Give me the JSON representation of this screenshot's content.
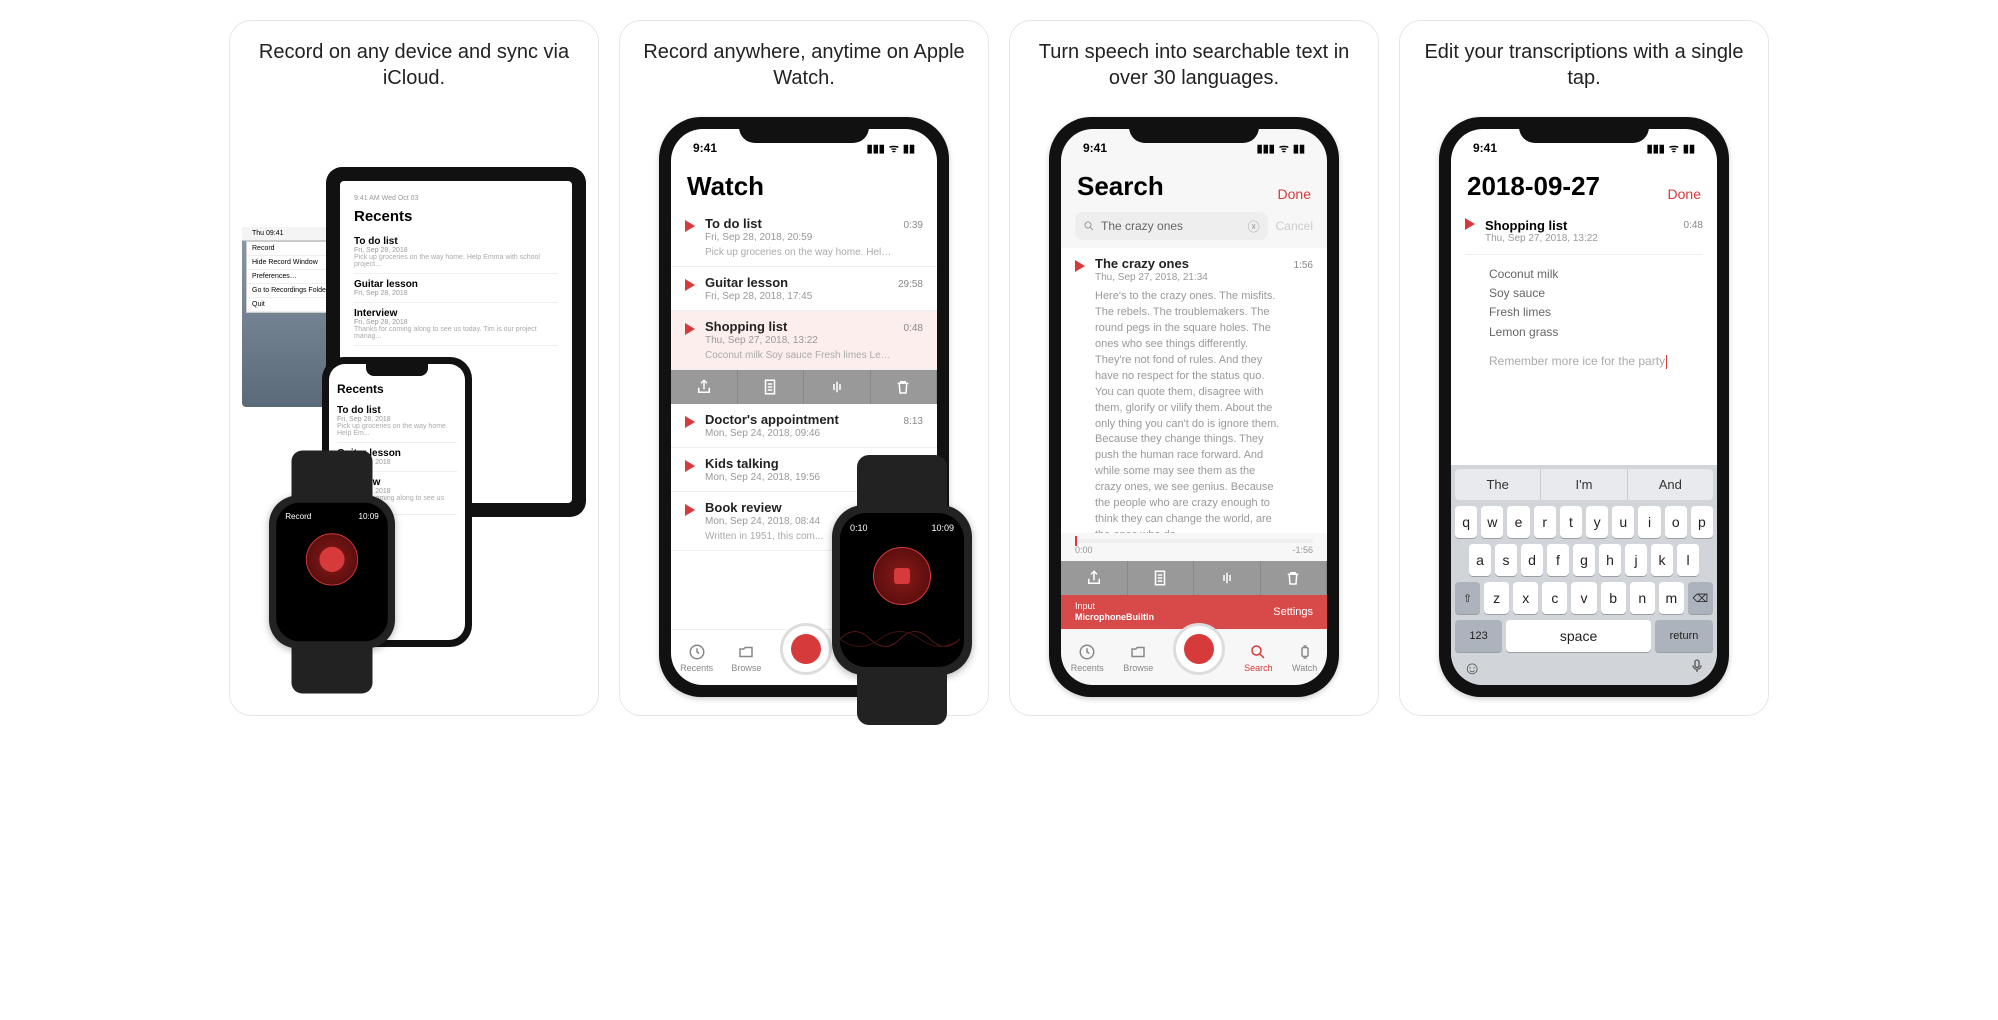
{
  "shots": [
    {
      "caption": "Record on any device and sync via iCloud."
    },
    {
      "caption": "Record anywhere, anytime on Apple Watch."
    },
    {
      "caption": "Turn speech into searchable text in over 30 languages."
    },
    {
      "caption": "Edit your transcriptions with a single tap."
    }
  ],
  "status": {
    "time": "9:41"
  },
  "accent": "#d63a3a",
  "shot1": {
    "mac": {
      "menubar_time": "Thu 09:41",
      "menu_items": [
        "Record",
        "Hide Record Window",
        "Preferences…",
        "Go to Recordings Folder",
        "Quit"
      ]
    },
    "ipad": {
      "statusbar": "9:41 AM   Wed Oct 03",
      "title": "Recents",
      "items": [
        {
          "title": "To do list",
          "sub": "Fri, Sep 28, 2018",
          "preview": "Pick up groceries on the way home. Help Emma with school project..."
        },
        {
          "title": "Guitar lesson",
          "sub": "Fri, Sep 28, 2018"
        },
        {
          "title": "Interview",
          "sub": "Fri, Sep 28, 2018",
          "preview": "Thanks for coming along to see us today. Tim is our project manag..."
        }
      ]
    },
    "iphone": {
      "title": "Recents",
      "items": [
        {
          "title": "To do list",
          "sub": "Fri, Sep 28, 2018",
          "preview": "Pick up groceries on the way home. Help Em..."
        },
        {
          "title": "Guitar lesson",
          "sub": "Fri, Sep 28, 2018"
        },
        {
          "title": "Interview",
          "sub": "Fri, Sep 28, 2018",
          "preview": "Thanks for coming along to see us today. Ti..."
        }
      ]
    },
    "watch": {
      "label": "Record",
      "time": "10:09"
    }
  },
  "shot2": {
    "title": "Watch",
    "items": [
      {
        "title": "To do list",
        "sub": "Fri, Sep 28, 2018, 20:59",
        "dur": "0:39",
        "preview": "Pick up groceries on the way home. Help Em..."
      },
      {
        "title": "Guitar lesson",
        "sub": "Fri, Sep 28, 2018, 17:45",
        "dur": "29:58"
      },
      {
        "title": "Shopping list",
        "sub": "Thu, Sep 27, 2018, 13:22",
        "dur": "0:48",
        "preview": "Coconut milk Soy sauce Fresh limes Lemon g...",
        "selected": true
      },
      {
        "title": "Doctor's appointment",
        "sub": "Mon, Sep 24, 2018, 09:46",
        "dur": "8:13"
      },
      {
        "title": "Kids talking",
        "sub": "Mon, Sep 24, 2018, 19:56",
        "dur": ""
      },
      {
        "title": "Book review",
        "sub": "Mon, Sep 24, 2018, 08:44",
        "dur": "",
        "preview": "Written in 1951, this com..."
      }
    ],
    "tabs": [
      "Recents",
      "Browse"
    ],
    "watch": {
      "elapsed": "0:10",
      "time": "10:09"
    }
  },
  "shot3": {
    "title": "Search",
    "done": "Done",
    "query": "The crazy ones",
    "cancel": "Cancel",
    "result": {
      "title": "The crazy ones",
      "sub": "Thu, Sep 27, 2018, 21:34",
      "dur": "1:56",
      "transcript": "Here's to the crazy ones. The misfits. The rebels. The troublemakers. The round pegs in the square holes. The ones who see things differently. They're not fond of rules. And they have no respect for the status quo. You can quote them, disagree with them, glorify or vilify them. About the only thing you can't do is ignore them. Because they change things. They push the human race forward. And while some may see them as the crazy ones, we see genius. Because the people who are crazy enough to think they can change the world, are the ones who do."
    },
    "track": {
      "start": "0:00",
      "end": "-1:56"
    },
    "input": {
      "label": "Input",
      "device": "MicrophoneBuiltIn",
      "settings": "Settings"
    },
    "tabs": [
      "Recents",
      "Browse",
      "Search",
      "Watch"
    ],
    "active_tab": "Search"
  },
  "shot4": {
    "title": "2018-09-27",
    "done": "Done",
    "item": {
      "title": "Shopping list",
      "sub": "Thu, Sep 27, 2018, 13:22",
      "dur": "0:48"
    },
    "lines": [
      "Coconut milk",
      "Soy sauce",
      "Fresh limes",
      "Lemon grass"
    ],
    "note": "Remember more ice for the party",
    "predictions": [
      "The",
      "I'm",
      "And"
    ],
    "rows": [
      [
        "q",
        "w",
        "e",
        "r",
        "t",
        "y",
        "u",
        "i",
        "o",
        "p"
      ],
      [
        "a",
        "s",
        "d",
        "f",
        "g",
        "h",
        "j",
        "k",
        "l"
      ],
      [
        "z",
        "x",
        "c",
        "v",
        "b",
        "n",
        "m"
      ]
    ],
    "fn": {
      "shift": "⇧",
      "backspace": "⌫",
      "num": "123",
      "space": "space",
      "return": "return"
    }
  }
}
